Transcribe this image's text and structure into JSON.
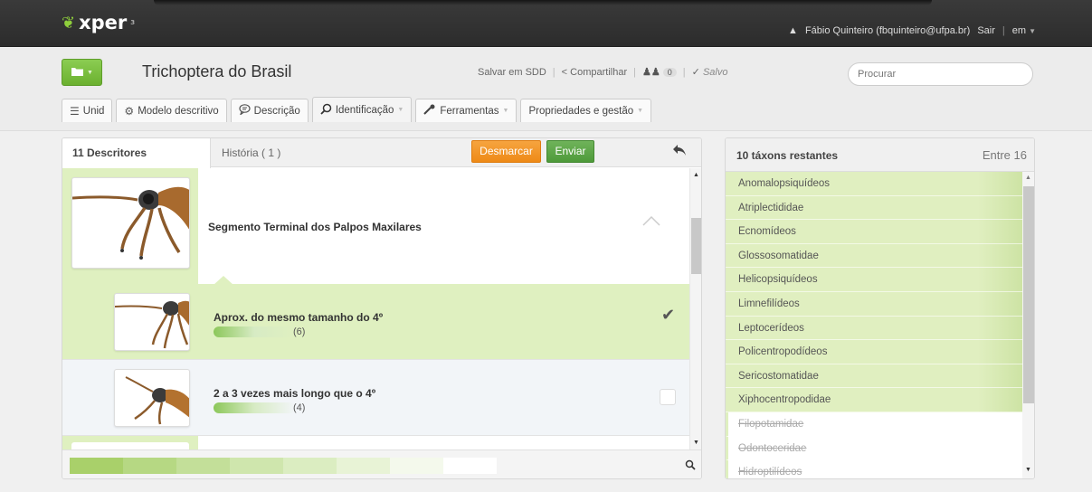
{
  "app": {
    "logo_text": "xper",
    "logo_sup": "3",
    "user": "Fábio Quinteiro (fbquinteiro@ufpa.br)",
    "logout": "Sair",
    "separator": "|",
    "language": "em"
  },
  "header": {
    "project_title": "Trichoptera do Brasil",
    "save_sdd": "Salvar em SDD",
    "share": "Compartilhar",
    "users_count": "0",
    "saved_status": "Salvo",
    "search_placeholder": "Procurar"
  },
  "tabs": [
    {
      "label": "Unid"
    },
    {
      "label": "Modelo descritivo"
    },
    {
      "label": "Descrição"
    },
    {
      "label": "Identificação"
    },
    {
      "label": "Ferramentas"
    },
    {
      "label": "Propriedades e gestão"
    }
  ],
  "left_panel": {
    "descriptors_tab": "11 Descritores",
    "history_tab": "História ( 1 )",
    "desmarcar": "Desmarcar",
    "enviar": "Enviar",
    "descriptor_title": "Segmento Terminal dos Palpos Maxilares",
    "states": [
      {
        "label": "Aprox. do mesmo tamanho do 4º",
        "count": "(6)",
        "selected": true
      },
      {
        "label": "2 a 3 vezes mais longo que o 4º",
        "count": "(4)",
        "selected": false
      }
    ],
    "progress_colors": [
      "#a9d06a",
      "#b6d883",
      "#c3df99",
      "#cfe6ad",
      "#dbedc1",
      "#e8f3d6",
      "#f4f9ec",
      "#ffffff"
    ]
  },
  "right_panel": {
    "title": "10 táxons restantes",
    "right_label": "Entre 16",
    "taxa_remaining": [
      "Anomalopsiquídeos",
      "Atriplectididae",
      "Ecnomídeos",
      "Glossosomatidae",
      "Helicopsiquídeos",
      "Limnefilídeos",
      "Leptocerídeos",
      "Policentropodídeos",
      "Sericostomatidae",
      "Xiphocentropodidae"
    ],
    "taxa_eliminated": [
      "Filopotamidae",
      "Odontoceridae",
      "Hidroptilídeos"
    ]
  },
  "colors": {
    "accent_green": "#6bb02f",
    "orange": "#ee8a17",
    "selected_row": "#dff0c0"
  }
}
